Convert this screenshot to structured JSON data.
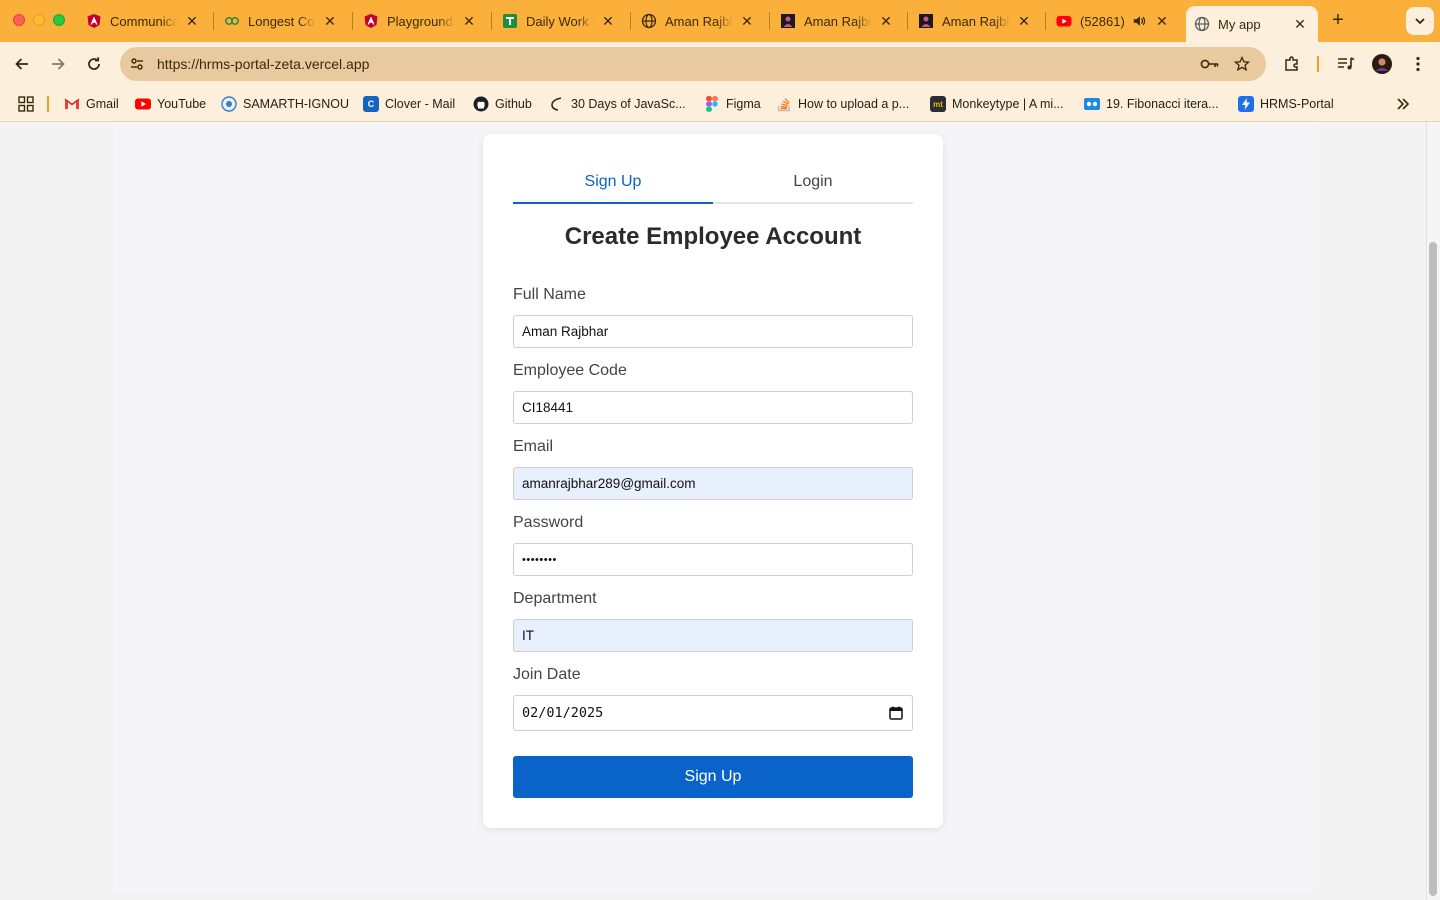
{
  "browser": {
    "tabs": [
      {
        "title": "Communication",
        "icon": "angular-icon"
      },
      {
        "title": "Longest Common",
        "icon": "geeksforgeeks-icon"
      },
      {
        "title": "Playground",
        "icon": "angular-icon"
      },
      {
        "title": "Daily Work Log",
        "icon": "sheets-icon"
      },
      {
        "title": "Aman Rajbhar",
        "icon": "globe-icon"
      },
      {
        "title": "Aman Rajbhar",
        "icon": "profile-icon"
      },
      {
        "title": "Aman Rajbhar",
        "icon": "profile-icon"
      },
      {
        "title": "(52861)",
        "icon": "youtube-icon"
      },
      {
        "title": "My app",
        "icon": "globe-icon"
      }
    ],
    "active_tab": 8,
    "url": "https://hrms-portal-zeta.vercel.app",
    "bookmarks": [
      {
        "label": "Gmail",
        "icon": "gmail-icon"
      },
      {
        "label": "YouTube",
        "icon": "youtube-icon"
      },
      {
        "label": "SAMARTH-IGNOU",
        "icon": "ignou-icon"
      },
      {
        "label": "Clover - Mail",
        "icon": "clover-icon"
      },
      {
        "label": "Github",
        "icon": "github-icon"
      },
      {
        "label": "30 Days of JavaSc...",
        "icon": "js-icon"
      },
      {
        "label": "Figma",
        "icon": "figma-icon"
      },
      {
        "label": "How to upload a p...",
        "icon": "stackoverflow-icon"
      },
      {
        "label": "Monkeytype | A mi...",
        "icon": "monkeytype-icon"
      },
      {
        "label": "19. Fibonacci itera...",
        "icon": "bookmark-icon"
      },
      {
        "label": "HRMS-Portal",
        "icon": "bolt-icon"
      }
    ],
    "colors": {
      "tabbar": "#fbb03b",
      "toolbar": "#fcf0dc",
      "accent": "#0a63c9"
    }
  },
  "form": {
    "tabs": [
      {
        "label": "Sign Up"
      },
      {
        "label": "Login"
      }
    ],
    "active_tab": 0,
    "title": "Create Employee Account",
    "fields": [
      {
        "label": "Full Name",
        "value": "Aman Rajbhar"
      },
      {
        "label": "Employee Code",
        "value": "CI18441"
      },
      {
        "label": "Email",
        "value": "amanrajbhar289@gmail.com"
      },
      {
        "label": "Password",
        "value": "••••••••"
      },
      {
        "label": "Department",
        "value": "IT"
      },
      {
        "label": "Join Date",
        "value": "02/01/2025"
      }
    ],
    "submit_label": "Sign Up"
  }
}
